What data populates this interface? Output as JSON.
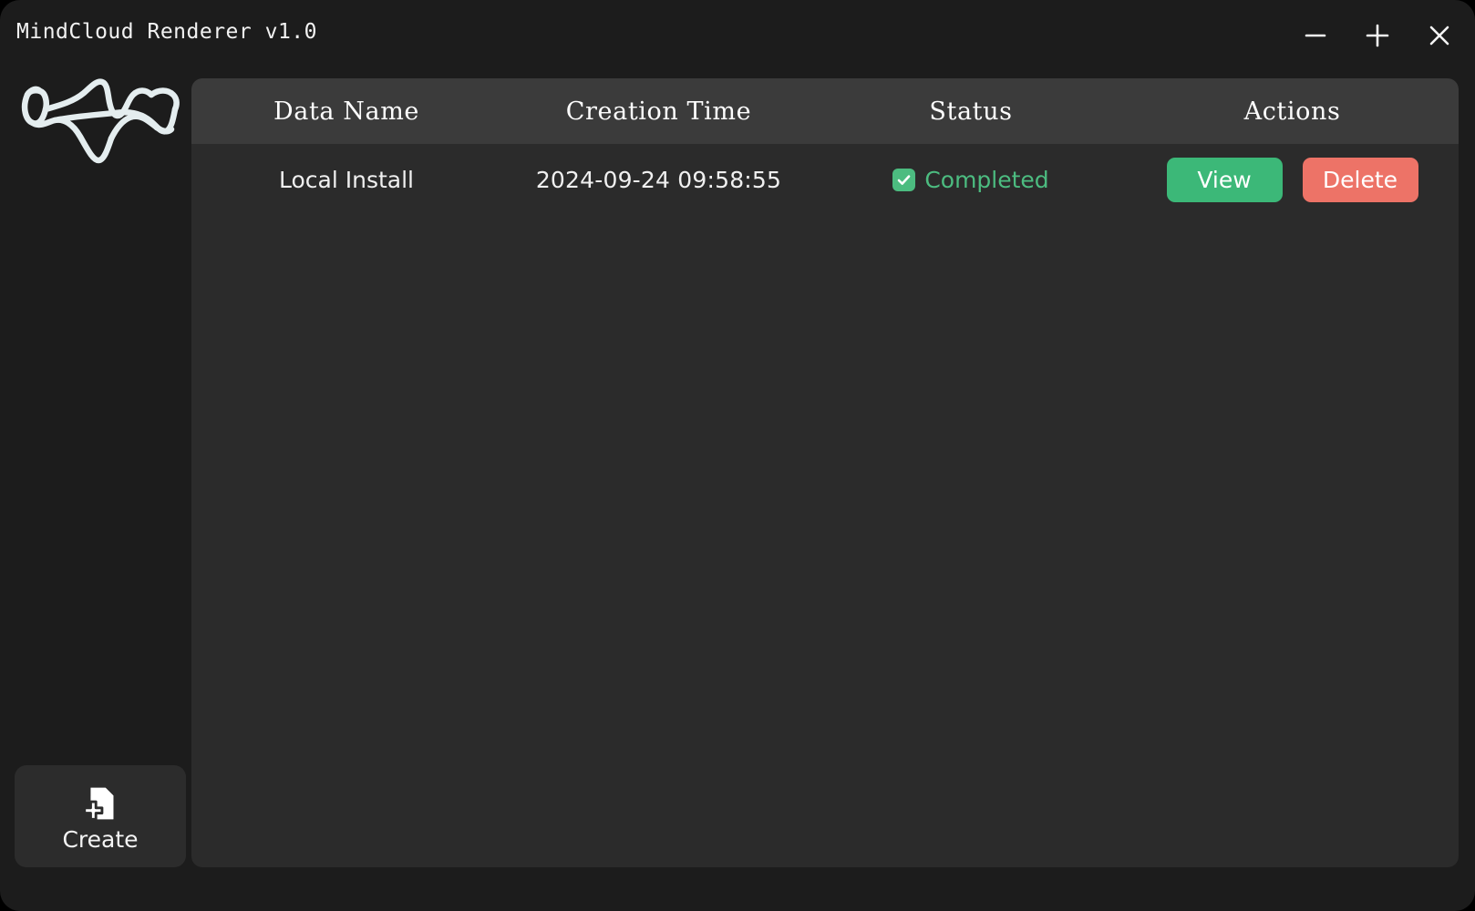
{
  "window": {
    "title": "MindCloud Renderer v1.0",
    "background_color": "#1c1c1c",
    "controls": [
      {
        "name": "minimize",
        "glyph": "−",
        "label": "Minimize"
      },
      {
        "name": "maximize",
        "glyph": "+",
        "label": "Maximize"
      },
      {
        "name": "close",
        "glyph": "×",
        "label": "Close"
      }
    ]
  },
  "sidebar": {
    "logo": {
      "icon": "scribble-wave-logo",
      "color": "#e6eef0"
    },
    "create_button": {
      "label": "Create",
      "icon": "file-plus-icon",
      "background_color": "#2c2c2c"
    }
  },
  "table": {
    "header_background": "#3b3b3b",
    "body_background": "#2b2b2b",
    "columns": [
      {
        "key": "data_name",
        "label": "Data Name"
      },
      {
        "key": "creation_time",
        "label": "Creation Time"
      },
      {
        "key": "status",
        "label": "Status"
      },
      {
        "key": "actions",
        "label": "Actions"
      }
    ],
    "rows": [
      {
        "data_name": "Local Install",
        "creation_time": "2024-09-24 09:58:55",
        "status": {
          "label": "Completed",
          "checked": true,
          "color": "#4cbc80",
          "icon": "checkbox-checked-icon"
        },
        "actions": [
          {
            "name": "view",
            "label": "View",
            "color": "#3cb878"
          },
          {
            "name": "delete",
            "label": "Delete",
            "color": "#ed7367"
          }
        ]
      }
    ]
  }
}
